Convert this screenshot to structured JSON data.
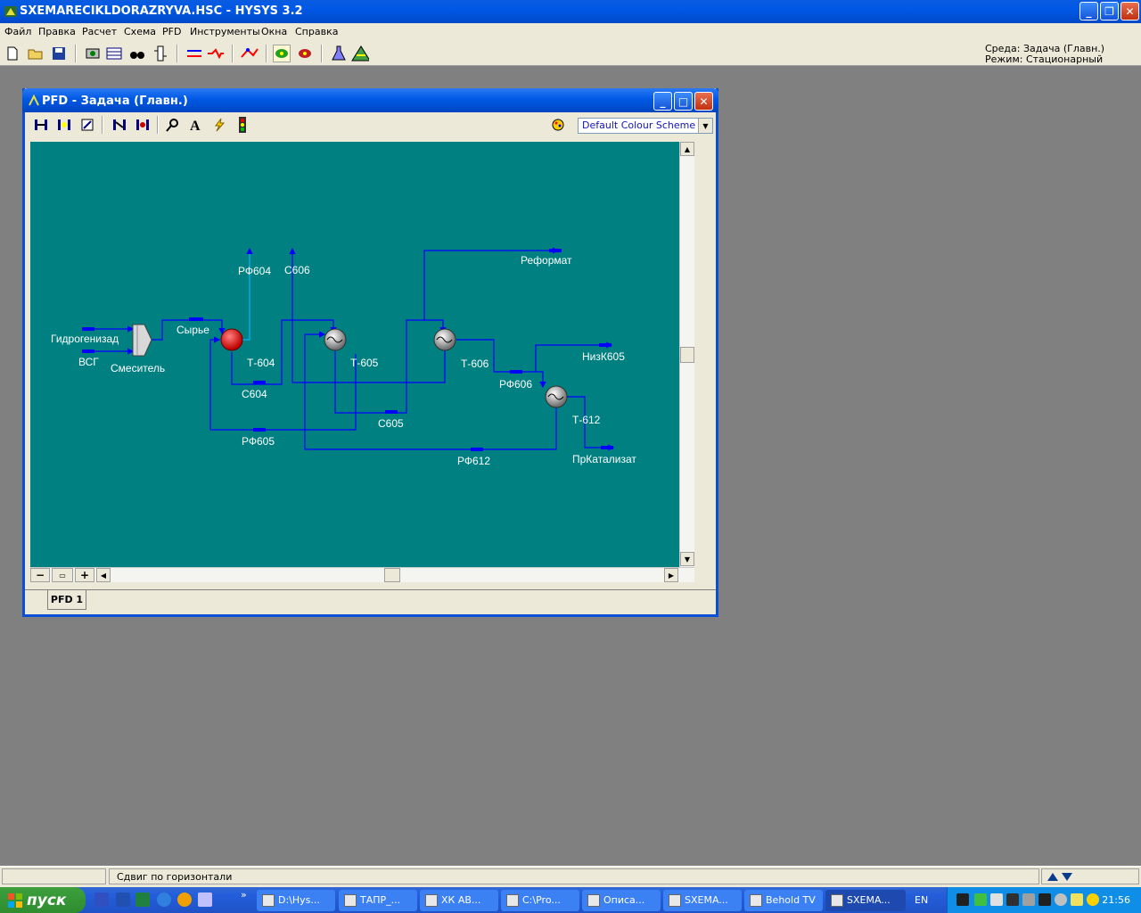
{
  "app": {
    "title": "SXEMARECIKLDORAZRYVA.HSC - HYSYS 3.2",
    "environment": "Среда: Задача (Главн.)",
    "mode": "Режим: Стационарный"
  },
  "menu": {
    "items": [
      "Файл",
      "Правка",
      "Расчет",
      "Схема",
      "PFD",
      "Инструменты",
      "Окна",
      "Справка"
    ]
  },
  "pfd": {
    "title": "PFD - Задача (Главн.)",
    "color_scheme": "Default Colour Scheme",
    "tab": "PFD 1"
  },
  "diagram": {
    "streams": {
      "hydrogenizad": "Гидрогенизад",
      "vsg": "ВСГ",
      "syrye": "Сырье",
      "rf604": "РФ604",
      "s606": "С606",
      "reformat": "Реформат",
      "s604": "С604",
      "rf605": "РФ605",
      "s605": "С605",
      "rf606": "РФ606",
      "nizk605": "НизК605",
      "rf612": "РФ612",
      "prkatalizat": "ПрКатализат"
    },
    "units": {
      "mixer": "Смеситель",
      "t604": "Т-604",
      "t605": "Т-605",
      "t606": "Т-606",
      "t612": "Т-612"
    }
  },
  "status": {
    "message": "Сдвиг по горизонтали"
  },
  "taskbar": {
    "start": "пуск",
    "tasks": [
      "D:\\Hys...",
      "ТАПР_...",
      "ХК АВ...",
      "C:\\Pro...",
      "Описа...",
      "SXEMA...",
      "Behold TV",
      "SXEMA..."
    ],
    "lang": "EN",
    "clock": "21:56"
  },
  "colors": {
    "canvas": "#008080",
    "stream": "#0000ff",
    "energy_stream": "#00b4ff",
    "heater": "#ff0000"
  }
}
